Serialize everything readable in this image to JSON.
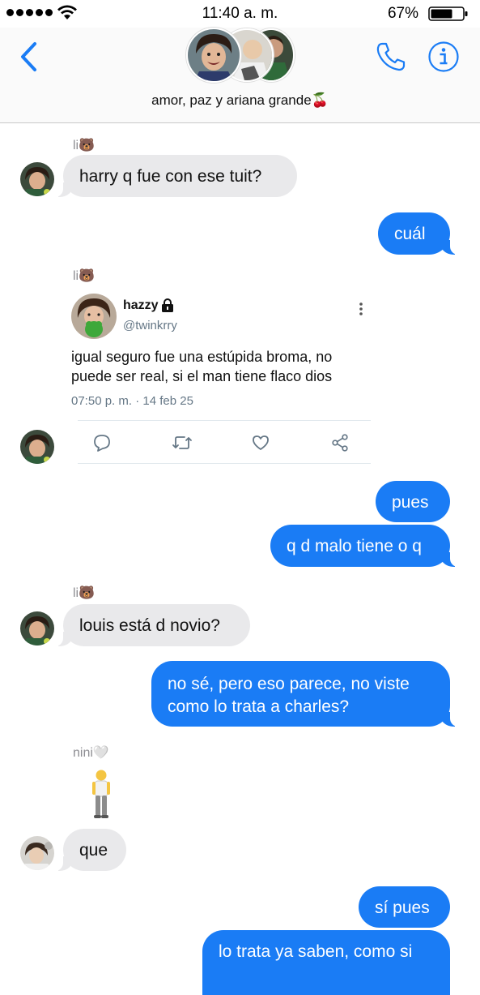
{
  "status_bar": {
    "time": "11:40 a. m.",
    "battery": "67%"
  },
  "header": {
    "group_name": "amor, paz y ariana grande🍒"
  },
  "messages": [
    {
      "sender": "li🐻",
      "text": "harry q fue con ese tuit?",
      "direction": "incoming"
    },
    {
      "text": "cuál",
      "direction": "outgoing"
    },
    {
      "sender": "li🐻",
      "direction": "incoming",
      "type": "tweet"
    },
    {
      "text": "pues",
      "direction": "outgoing"
    },
    {
      "text": "q d malo tiene o q",
      "direction": "outgoing"
    },
    {
      "sender": "li🐻",
      "text": "louis está d novio?",
      "direction": "incoming"
    },
    {
      "text_lines": [
        "no sé, pero eso parece, no viste",
        "como lo trata a charles?"
      ],
      "direction": "outgoing"
    },
    {
      "sender": "nini🤍",
      "emoji": "🧍‍♂️",
      "text": "que",
      "direction": "incoming"
    },
    {
      "text": "sí pues",
      "direction": "outgoing"
    },
    {
      "text": "lo trata ya saben, como si",
      "direction": "outgoing"
    }
  ],
  "tweet": {
    "name": "hazzy",
    "handle": "@twinkrry",
    "text_lines": [
      "igual seguro fue una estúpida broma, no",
      "puede ser real, si el man tiene flaco dios"
    ],
    "time": "07:50 p. m.",
    "separator": "·",
    "date": "14 feb 25"
  },
  "colors": {
    "accent": "#1a7cf5",
    "incoming_bubble": "#e9e9eb"
  }
}
